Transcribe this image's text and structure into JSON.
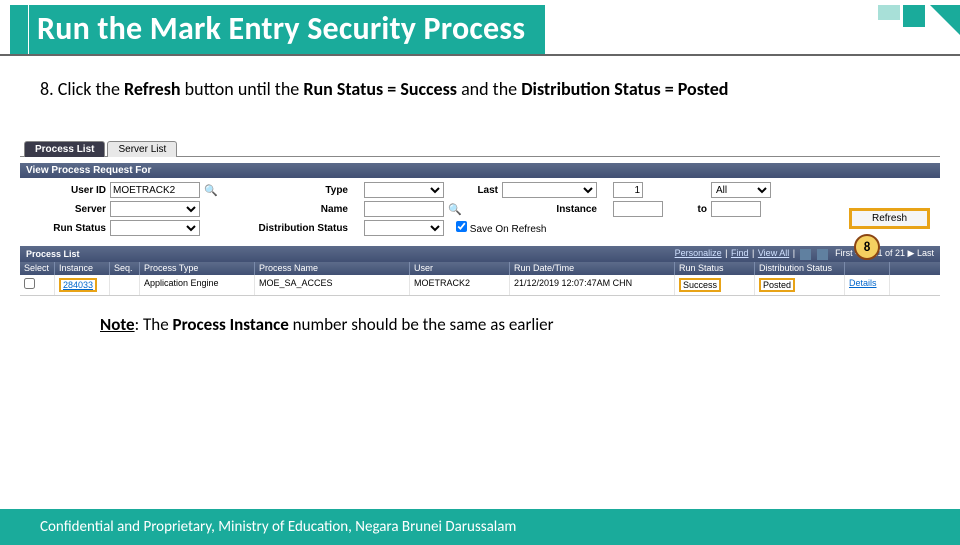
{
  "title": "Run the Mark Entry Security Process",
  "step": {
    "num": "8.",
    "t1": "Click the ",
    "b1": "Refresh ",
    "t2": "button until the ",
    "b2": "Run Status = Success ",
    "t3": "and the ",
    "b3": "Distribution Status = Posted"
  },
  "tabs": {
    "active": "Process List",
    "inactive": "Server List"
  },
  "section_hdr": "View Process Request For",
  "filters": {
    "user_lbl": "User ID",
    "user_val": "MOETRACK2",
    "type_lbl": "Type",
    "type_val": "",
    "last_lbl": "Last",
    "last_val": "1",
    "last_unit": "All",
    "server_lbl": "Server",
    "name_lbl": "Name",
    "instance_lbl": "Instance",
    "to_lbl": "to",
    "run_lbl": "Run Status",
    "dist_lbl": "Distribution Status",
    "save_lbl": "Save On Refresh",
    "refresh_btn": "Refresh"
  },
  "callout": "8",
  "list": {
    "hdr": "Process List",
    "personalize": "Personalize",
    "find": "Find",
    "viewall": "View All",
    "range": "First",
    "range2": "1-21 of 21",
    "range3": "Last",
    "cols": [
      "Select",
      "Instance",
      "Seq.",
      "Process Type",
      "Process Name",
      "User",
      "Run Date/Time",
      "Run Status",
      "Distribution Status",
      ""
    ],
    "row": {
      "instance": "284033",
      "seq": "",
      "ptype": "Application Engine",
      "pname": "MOE_SA_ACCES",
      "user": "MOETRACK2",
      "dt": "21/12/2019 12:07:47AM CHN",
      "rstatus": "Success",
      "dstatus": "Posted",
      "details": "Details"
    }
  },
  "note": {
    "b": "Note",
    "t1": ": The ",
    "b2": "Process Instance ",
    "t2": "number should be the same as earlier"
  },
  "footer": "Confidential and Proprietary, Ministry of Education, Negara Brunei Darussalam"
}
